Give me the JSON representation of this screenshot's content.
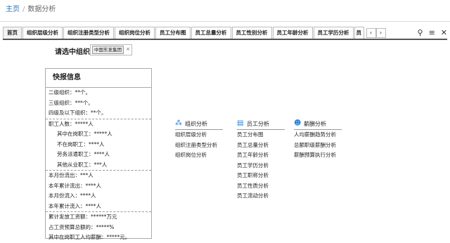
{
  "breadcrumb": {
    "home": "主页",
    "separator": "/",
    "current": "数据分析"
  },
  "tabs": [
    "首页",
    "组织层级分析",
    "组织注册类型分析",
    "组织岗位分析",
    "员工分布图",
    "员工总量分析",
    "员工性别分析",
    "员工年龄分析",
    "员工学历分析",
    "员"
  ],
  "tab_nav": {
    "prev": "‹",
    "next": "›"
  },
  "toolbar": {
    "filter_icon": "⚲",
    "menu_icon": "≡",
    "close_icon": "✕"
  },
  "selector": {
    "label": "请选中组织",
    "chip": "中国东发集团",
    "remove": "×"
  },
  "quick_info": {
    "title": "快报信息",
    "group1": [
      "二级组织：**个。",
      "三级组织：***个。",
      "四级及以下组织：**个。"
    ],
    "group2": [
      "职工人数：*****人",
      "其中在岗职工：*****人",
      "不在岗职工：****人",
      "劳务派遣职工：****人",
      "其他从业职工：***人"
    ],
    "group3": [
      "本月份流出：***人",
      "本年累计流出：****人",
      "本月份流入：****人",
      "本年累计流入：****人"
    ],
    "group4": [
      "累计发放工资额：******万元",
      "占工资预算总额的：*****%",
      "其中在岗职工人均薪酬：*****元。"
    ]
  },
  "categories": [
    {
      "icon": "org-icon",
      "title": "组织分析",
      "items": [
        "组织层级分析",
        "组织注册类型分析",
        "组织岗位分析"
      ]
    },
    {
      "icon": "staff-icon",
      "title": "员工分析",
      "items": [
        "员工分布图",
        "员工总量分析",
        "员工年龄分析",
        "员工学历分析",
        "员工职称分析",
        "员工性质分析",
        "员工流动分析"
      ]
    },
    {
      "icon": "salary-icon",
      "title": "薪酬分析",
      "items": [
        "人均薪酬趋势分析",
        "总额职级薪酬分析",
        "薪酬预算执行分析"
      ]
    }
  ]
}
